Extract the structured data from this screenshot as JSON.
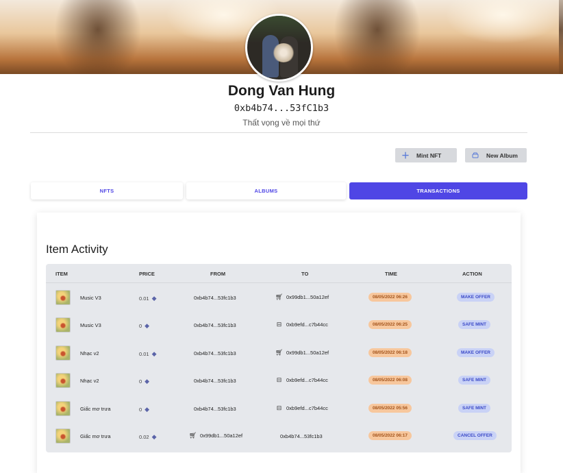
{
  "profile": {
    "name": "Dong Van Hung",
    "address": "0xb4b74...53fC1b3",
    "bio": "Thất vọng về mọi thứ"
  },
  "actions": {
    "mint_label": "Mint NFT",
    "mint_icon": "plus-icon",
    "album_label": "New Album",
    "album_icon": "album-icon"
  },
  "tabs": [
    {
      "label": "NFTS",
      "active": false
    },
    {
      "label": "ALBUMS",
      "active": false
    },
    {
      "label": "TRANSACTIONS",
      "active": true
    }
  ],
  "activity": {
    "title": "Item Activity",
    "columns": [
      "ITEM",
      "PRICE",
      "FROM",
      "TO",
      "TIME",
      "ACTION"
    ],
    "rows": [
      {
        "item": "Music V3",
        "price": "0.01",
        "from": "0xb4b74...53fc1b3",
        "to": "0x99db1...50a12ef",
        "to_icon": "cart-icon",
        "time": "08/05/2022 06:26",
        "action": "MAKE OFFER"
      },
      {
        "item": "Music V3",
        "price": "0",
        "from": "0xb4b74...53fc1b3",
        "to": "0xb9efd...c7b44cc",
        "to_icon": "box-icon",
        "time": "08/05/2022 06:25",
        "action": "SAFE MINT"
      },
      {
        "item": "Nhạc v2",
        "price": "0.01",
        "from": "0xb4b74...53fc1b3",
        "to": "0x99db1...50a12ef",
        "to_icon": "cart-icon",
        "time": "08/05/2022 06:18",
        "action": "MAKE OFFER"
      },
      {
        "item": "Nhạc v2",
        "price": "0",
        "from": "0xb4b74...53fc1b3",
        "to": "0xb9efd...c7b44cc",
        "to_icon": "box-icon",
        "time": "08/05/2022 06:08",
        "action": "SAFE MINT"
      },
      {
        "item": "Giấc mơ trưa",
        "price": "0",
        "from": "0xb4b74...53fc1b3",
        "to": "0xb9efd...c7b44cc",
        "to_icon": "box-icon",
        "time": "08/05/2022 05:56",
        "action": "SAFE MINT"
      },
      {
        "item": "Giấc mơ trưa",
        "price": "0.02",
        "from": "0x99db1...50a12ef",
        "from_icon": "cart-icon",
        "to": "0xb4b74...53fc1b3",
        "time": "08/05/2022 06:17",
        "action": "CANCEL OFFER"
      }
    ]
  },
  "colors": {
    "accent": "#4f46e5",
    "time_badge_bg": "#f7c79d",
    "action_badge_bg": "#c9d2f6"
  }
}
